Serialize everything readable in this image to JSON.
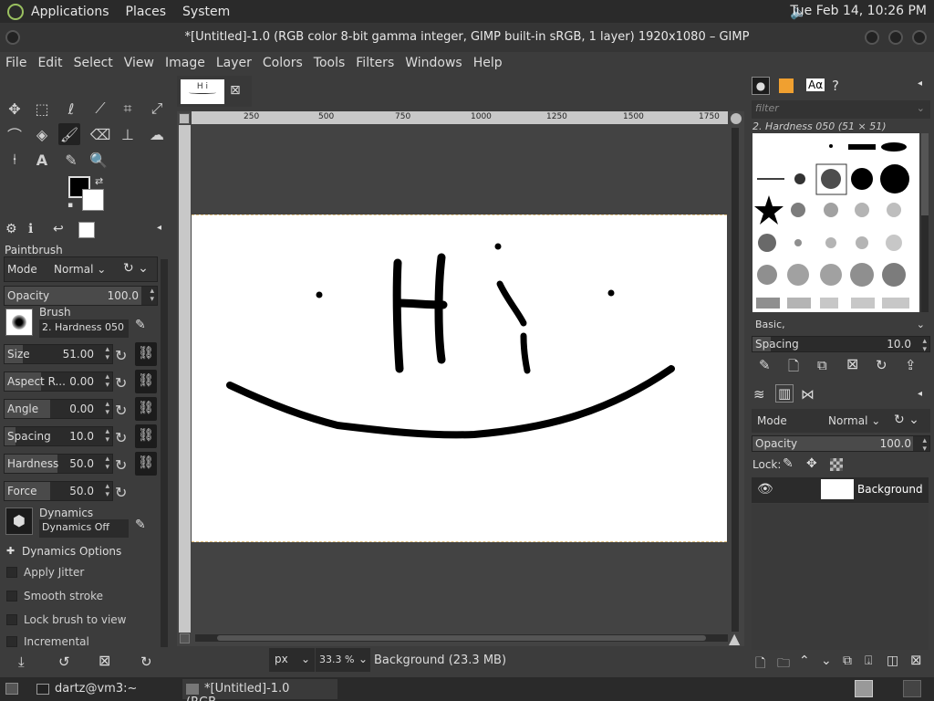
{
  "desktop": {
    "applications_label": "Applications",
    "places_label": "Places",
    "system_label": "System",
    "clock": "Tue Feb 14, 10:26 PM"
  },
  "window": {
    "title": "*[Untitled]-1.0 (RGB color 8-bit gamma integer, GIMP built-in sRGB, 1 layer) 1920x1080 – GIMP"
  },
  "menubar": [
    "File",
    "Edit",
    "Select",
    "View",
    "Image",
    "Layer",
    "Colors",
    "Tools",
    "Filters",
    "Windows",
    "Help"
  ],
  "image_tab_thumb_text": "H i",
  "ruler_ticks": [
    "250",
    "500",
    "750",
    "1000",
    "1250",
    "1500",
    "1750"
  ],
  "tool_options": {
    "title": "Paintbrush",
    "mode_label": "Mode",
    "mode_value": "Normal",
    "opacity_label": "Opacity",
    "opacity_value": "100.0",
    "brush_label": "Brush",
    "brush_value": "2. Hardness 050",
    "size_label": "Size",
    "size_value": "51.00",
    "aspect_label": "Aspect R...",
    "aspect_value": "0.00",
    "angle_label": "Angle",
    "angle_value": "0.00",
    "spacing_label": "Spacing",
    "spacing_value": "10.0",
    "hardness_label": "Hardness",
    "hardness_value": "50.0",
    "force_label": "Force",
    "force_value": "50.0",
    "dynamics_label": "Dynamics",
    "dynamics_value": "Dynamics Off",
    "dynamics_options_label": "Dynamics Options",
    "apply_jitter_label": "Apply Jitter",
    "smooth_stroke_label": "Smooth stroke",
    "lock_brush_label": "Lock brush to view",
    "incremental_label": "Incremental"
  },
  "statusbar": {
    "unit": "px",
    "zoom": "33.3 %",
    "layer_info": "Background (23.3 MB)"
  },
  "brushes": {
    "filter_placeholder": "filter",
    "selected_brush": "2. Hardness 050 (51 × 51)",
    "tag": "Basic,",
    "spacing_label": "Spacing",
    "spacing_value": "10.0"
  },
  "layers": {
    "mode_label": "Mode",
    "mode_value": "Normal",
    "opacity_label": "Opacity",
    "opacity_value": "100.0",
    "lock_label": "Lock:",
    "layer_name": "Background"
  },
  "taskbar": {
    "terminal_label": "dartz@vm3:~",
    "gimp_label": "*[Untitled]-1.0 (RGB..."
  }
}
